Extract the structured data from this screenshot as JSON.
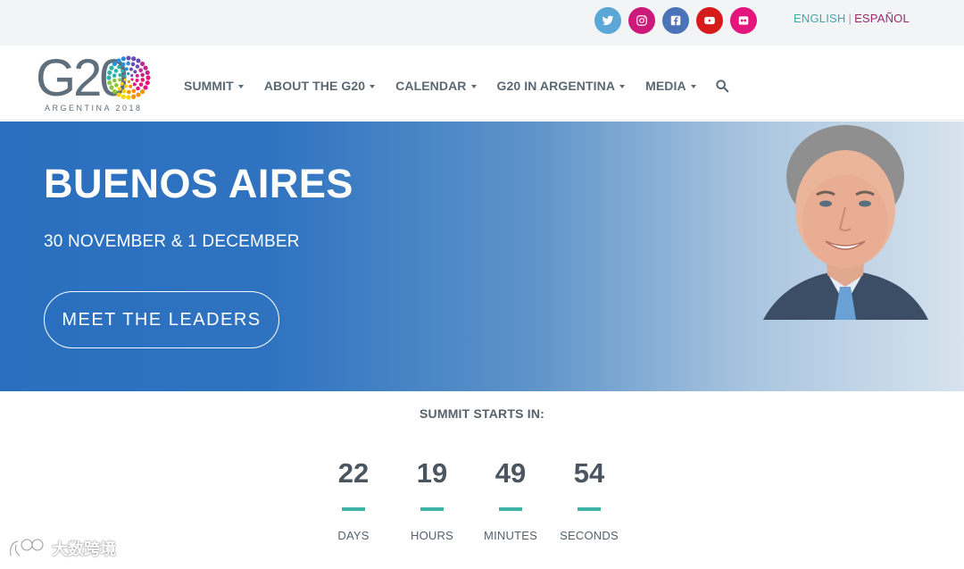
{
  "topbar": {
    "social": [
      {
        "icon": "twitter-icon",
        "color": "#5aa7d8"
      },
      {
        "icon": "instagram-icon",
        "color": "#cc1a7a"
      },
      {
        "icon": "facebook-icon",
        "color": "#4a73b8"
      },
      {
        "icon": "youtube-icon",
        "color": "#d61b1b"
      },
      {
        "icon": "flickr-icon",
        "color": "#e4157c"
      }
    ],
    "lang_english": "ENGLISH",
    "lang_separator": "|",
    "lang_espanol": "ESPAÑOL"
  },
  "header": {
    "logo_text": "G20",
    "logo_sub": "ARGENTINA 2018",
    "nav": [
      {
        "label": "SUMMIT"
      },
      {
        "label": "ABOUT THE G20"
      },
      {
        "label": "CALENDAR"
      },
      {
        "label": "G20 IN ARGENTINA"
      },
      {
        "label": "MEDIA"
      }
    ]
  },
  "hero": {
    "title": "BUENOS AIRES",
    "date": "30 NOVEMBER & 1 DECEMBER",
    "button": "MEET THE LEADERS"
  },
  "countdown": {
    "label": "SUMMIT STARTS IN:",
    "units": [
      {
        "value": "22",
        "label": "DAYS"
      },
      {
        "value": "19",
        "label": "HOURS"
      },
      {
        "value": "49",
        "label": "MINUTES"
      },
      {
        "value": "54",
        "label": "SECONDS"
      }
    ]
  },
  "watermark": {
    "text": "大数跨境"
  },
  "colors": {
    "accent_teal": "#3fb3a8",
    "hero_blue": "#2a6fbf",
    "language_active": "#3fa8a8",
    "language_other": "#9a2a6e"
  }
}
